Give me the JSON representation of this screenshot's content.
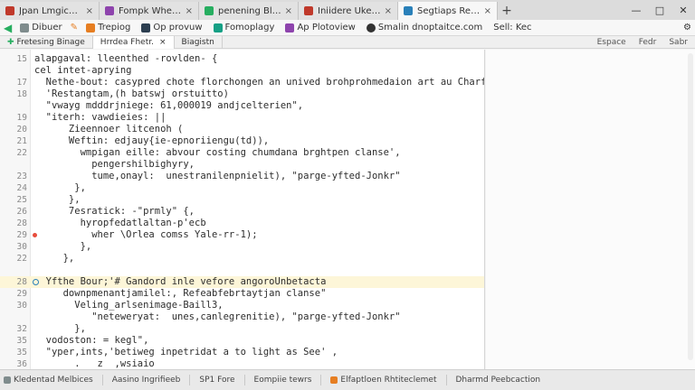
{
  "tabs": [
    {
      "label": "Jpan Lmgicede",
      "color": "#c0392b",
      "active": false
    },
    {
      "label": "Fompk Whelidco",
      "color": "#8e44ad",
      "active": false
    },
    {
      "label": "penening Blehedsapon",
      "color": "#27ae60",
      "active": false
    },
    {
      "label": "Iniidere Ukemilebicu",
      "color": "#c0392b",
      "active": false
    },
    {
      "label": "Segtiaps Reectioom",
      "color": "#2980b9",
      "active": true
    }
  ],
  "toolbar": {
    "items": [
      {
        "label": "Dibuer",
        "color": "#7f8c8d"
      },
      {
        "label": "Trepiog",
        "color": "#e67e22"
      },
      {
        "label": "Op provuw",
        "color": "#2c3e50"
      },
      {
        "label": "Fomoplagy",
        "color": "#16a085"
      },
      {
        "label": "Ap Plotoview",
        "color": "#8e44ad"
      },
      {
        "label": "Smalin dnoptaitce.com",
        "color": "#333333"
      },
      {
        "label": "Sell: Kec",
        "color": "#555555"
      }
    ]
  },
  "subbar": {
    "left": "Fretesing Binage",
    "tab": "Hrrdea Fhetr.",
    "tab2": "Biagistn",
    "right": [
      "Espace",
      "Fedr",
      "Sabr"
    ]
  },
  "editor": {
    "lines": [
      {
        "n": "15",
        "code": "alapgaval: lleenthed -rovlden- {"
      },
      {
        "n": "",
        "code": "cel intet-aprying"
      },
      {
        "n": "17",
        "code": "  Nethe-bout: casypred chote florchongen an unived brohprohmedaion art au Charfantanex:"
      },
      {
        "n": "18",
        "code": "  'Restangtam,(h batswj orstuitto)"
      },
      {
        "n": "",
        "code": "  \"vwayg mdddrjniege: 61,000019 andjcelterien\","
      },
      {
        "n": "19",
        "code": "  \"iterh: vawdieies: ||"
      },
      {
        "n": "20",
        "code": "      Zieennoer litcenoh ("
      },
      {
        "n": "21",
        "code": "      Weftin: edjauy{ie-epnoriiengu(td)),"
      },
      {
        "n": "22",
        "code": "        wmpigan eille: abvour costing chumdana brghtpen clanse',"
      },
      {
        "n": "",
        "code": "          pengershilbighyry,"
      },
      {
        "n": "23",
        "code": "          tume,onayl:  unestranilenpnielit), \"parge-yfted-Jonkr\""
      },
      {
        "n": "24",
        "code": "       },"
      },
      {
        "n": "25",
        "code": "      },"
      },
      {
        "n": "26",
        "code": "      7esratick: -\"prmly\" {,"
      },
      {
        "n": "28",
        "code": "        hyropfedatlaltan-p'ecb"
      },
      {
        "n": "29",
        "code": "          wher \\Orlea comss Yale-rr-1);"
      },
      {
        "n": "30",
        "code": "        },"
      },
      {
        "n": "22",
        "code": "     },"
      },
      {
        "n": "",
        "code": ""
      },
      {
        "n": "28",
        "code": "  Yfthe Bour;'# Gandord inle vefore angoroUnbetacta"
      },
      {
        "n": "29",
        "code": "     downpmenantjamilel:, Refeabfebrtaytjan clanse\""
      },
      {
        "n": "30",
        "code": "       Veling_arlsenimage-Baill3,"
      },
      {
        "n": "",
        "code": "          \"neteweryat:  unes,canlegrenitie), \"parge-yfted-Jonkr\""
      },
      {
        "n": "32",
        "code": "       },"
      },
      {
        "n": "35",
        "code": "  vodoston: = kegl\","
      },
      {
        "n": "35",
        "code": "  \"yper,ints,'betiweg inpetridat a to light as See' ,"
      },
      {
        "n": "36",
        "code": "       .   z  ,wsiaio"
      }
    ]
  },
  "status": {
    "items": [
      "Kledentad Melbices",
      "Aasino Ingrifieeb",
      "SP1 Fore",
      "Eompiie tewrs",
      "Elfaptloen Rhtiteclemet",
      "Dharmd Peebcaction"
    ]
  }
}
